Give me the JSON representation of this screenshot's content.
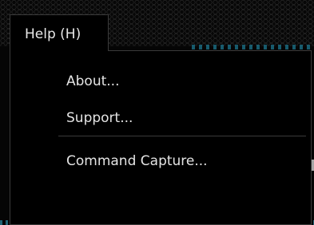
{
  "menu": {
    "title": "Help (H)",
    "items": [
      {
        "label": "About..."
      },
      {
        "label": "Support..."
      },
      {
        "label": "Command Capture..."
      }
    ]
  }
}
